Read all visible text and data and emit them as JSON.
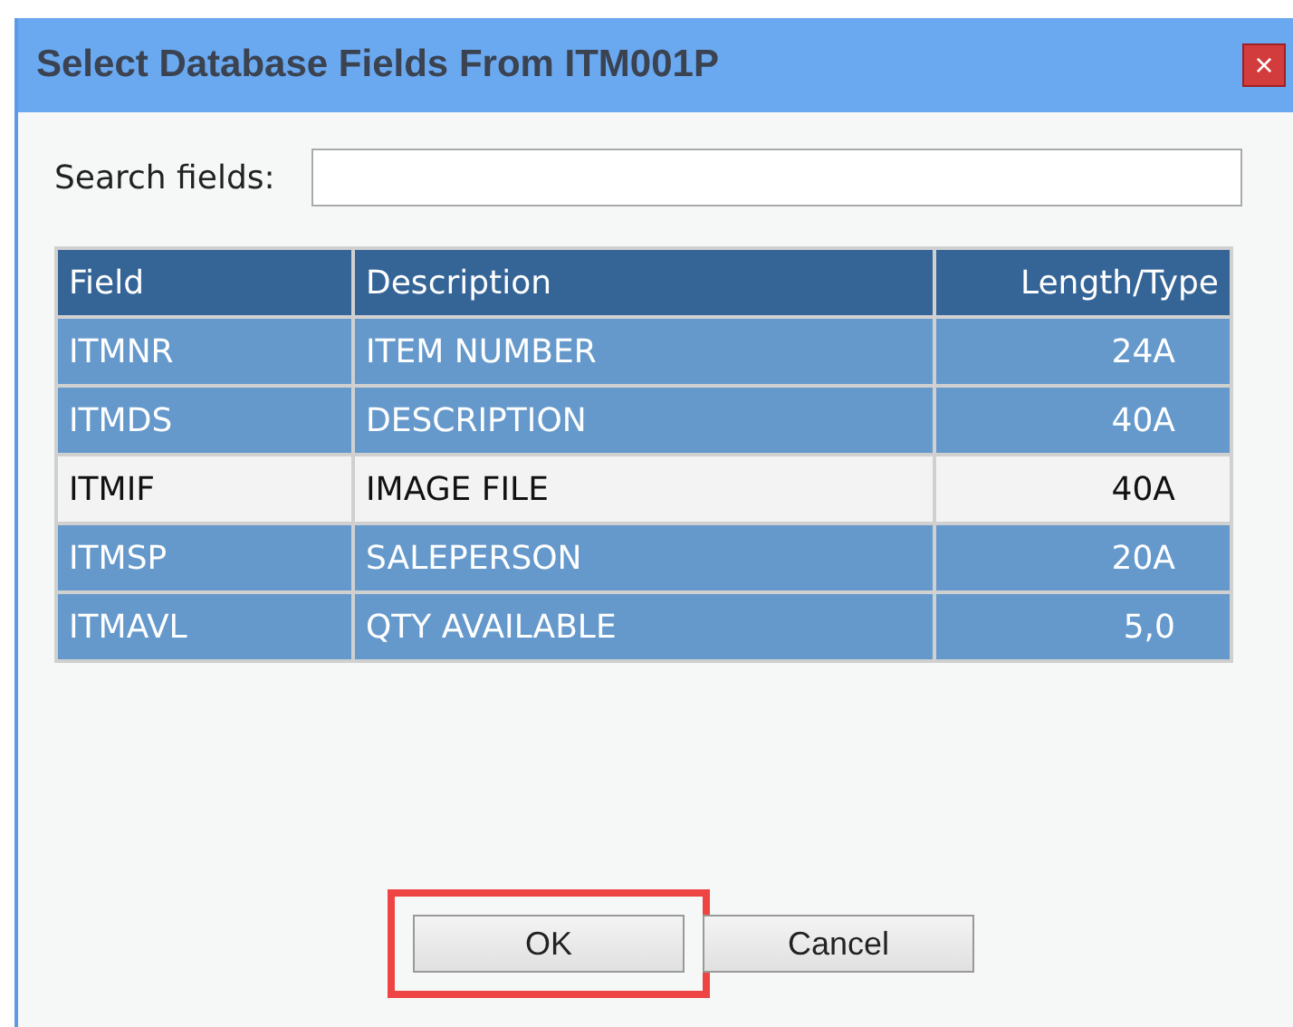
{
  "window": {
    "title": "Select Database Fields From ITM001P",
    "close": "×"
  },
  "search": {
    "label": "Search fields:"
  },
  "table": {
    "columns": [
      "Field",
      "Description",
      "Length/Type"
    ],
    "rows": [
      {
        "cells": [
          "ITMNR",
          "ITEM NUMBER",
          "24A"
        ],
        "selected": true
      },
      {
        "cells": [
          "ITMDS",
          "DESCRIPTION",
          "40A"
        ],
        "selected": true
      },
      {
        "cells": [
          "ITMIF",
          "IMAGE FILE",
          "40A"
        ],
        "selected": false
      },
      {
        "cells": [
          "ITMSP",
          "SALEPERSON",
          "20A"
        ],
        "selected": true
      },
      {
        "cells": [
          "ITMAVL",
          "QTY AVAILABLE",
          "5,0"
        ],
        "selected": true
      }
    ]
  },
  "buttons": [
    {
      "label": "OK",
      "highlighted": true
    },
    {
      "label": "Cancel",
      "highlighted": false
    }
  ]
}
